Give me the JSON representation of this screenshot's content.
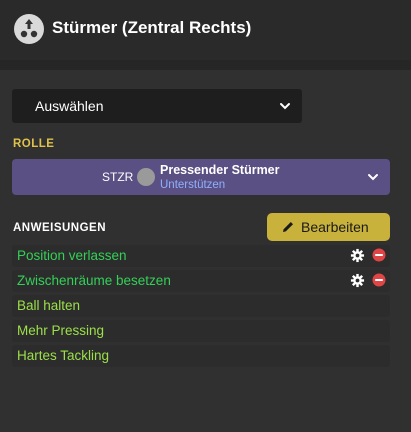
{
  "header": {
    "title": "Stürmer (Zentral Rechts)",
    "icon": "formation-icon"
  },
  "position_select": {
    "value": "Auswählen"
  },
  "role": {
    "section_label": "ROLLE",
    "abbreviation": "STZR",
    "name": "Pressender Stürmer",
    "duty": "Unterstützen"
  },
  "instructions": {
    "section_label": "ANWEISUNGEN",
    "edit_label": "Bearbeiten",
    "items": [
      {
        "label": "Position verlassen",
        "removable": true
      },
      {
        "label": "Zwischenräume besetzen",
        "removable": true
      },
      {
        "label": "Ball halten",
        "removable": false
      },
      {
        "label": "Mehr Pressing",
        "removable": false
      },
      {
        "label": "Hartes Tackling",
        "removable": false
      }
    ]
  },
  "colors": {
    "role_label": "#e0c24a",
    "instruction_green": "#34d058",
    "instruction_lime": "#9be04a",
    "role_bar": "#5b5083",
    "edit_button": "#c9b23c",
    "remove": "#e04545"
  }
}
